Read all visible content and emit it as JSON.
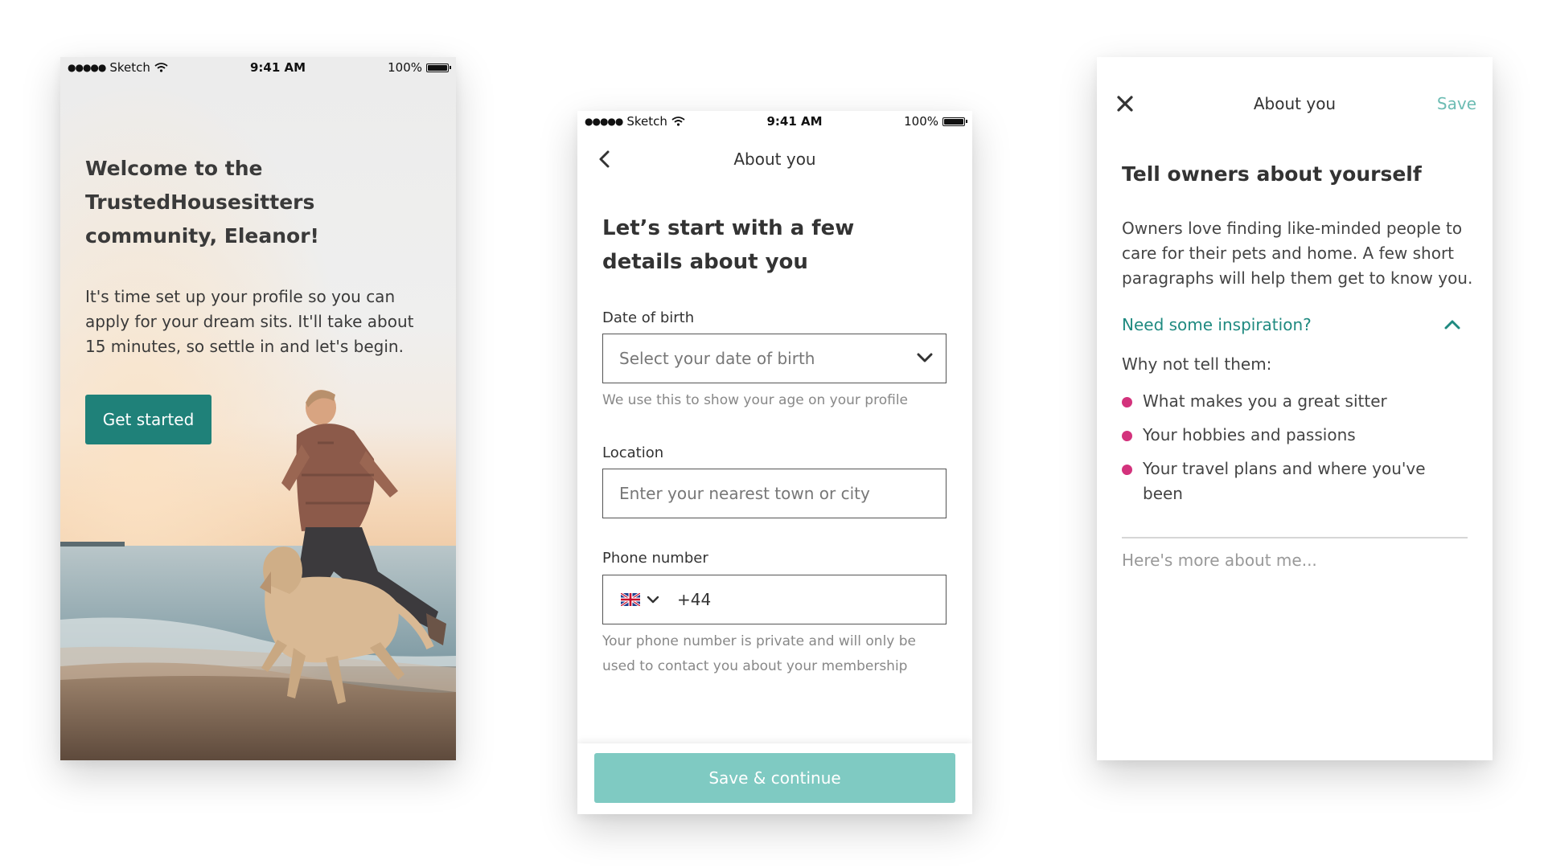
{
  "statusbar": {
    "carrier": "Sketch",
    "signal_dots": "●●●●●",
    "time": "9:41 AM",
    "battery": "100%"
  },
  "screen1": {
    "title": "Welcome to the TrustedHousesitters community, Eleanor!",
    "body": "It's time set up your profile so you can apply for your dream sits. It'll take about 15 minutes, so settle in and let's begin.",
    "cta_label": "Get started",
    "accent_color": "#1f8179"
  },
  "screen2": {
    "nav_title": "About you",
    "title": "Let’s start with a few details about you",
    "dob": {
      "label": "Date of birth",
      "placeholder": "Select your date of birth",
      "help": "We use this to show your age on your profile"
    },
    "location": {
      "label": "Location",
      "placeholder": "Enter your nearest town or city"
    },
    "phone": {
      "label": "Phone number",
      "country_icon": "uk-flag-icon",
      "value": "+44",
      "help": "Your phone number is private and will only be used to contact you about your membership"
    },
    "cta_label": "Save & continue",
    "cta_color": "#7fcac2"
  },
  "screen3": {
    "nav_title": "About you",
    "save_label": "Save",
    "title": "Tell owners about yourself",
    "body": "Owners love finding like-minded people to care for their pets and home. A few short paragraphs will help them get to know you.",
    "inspiration_label": "Need some inspiration?",
    "why_label": "Why not tell them:",
    "bullets": [
      "What makes you a great sitter",
      "Your hobbies and passions",
      "Your travel plans and where you've been"
    ],
    "textarea_placeholder": "Here's more about me...",
    "bullet_color": "#d3327c"
  }
}
